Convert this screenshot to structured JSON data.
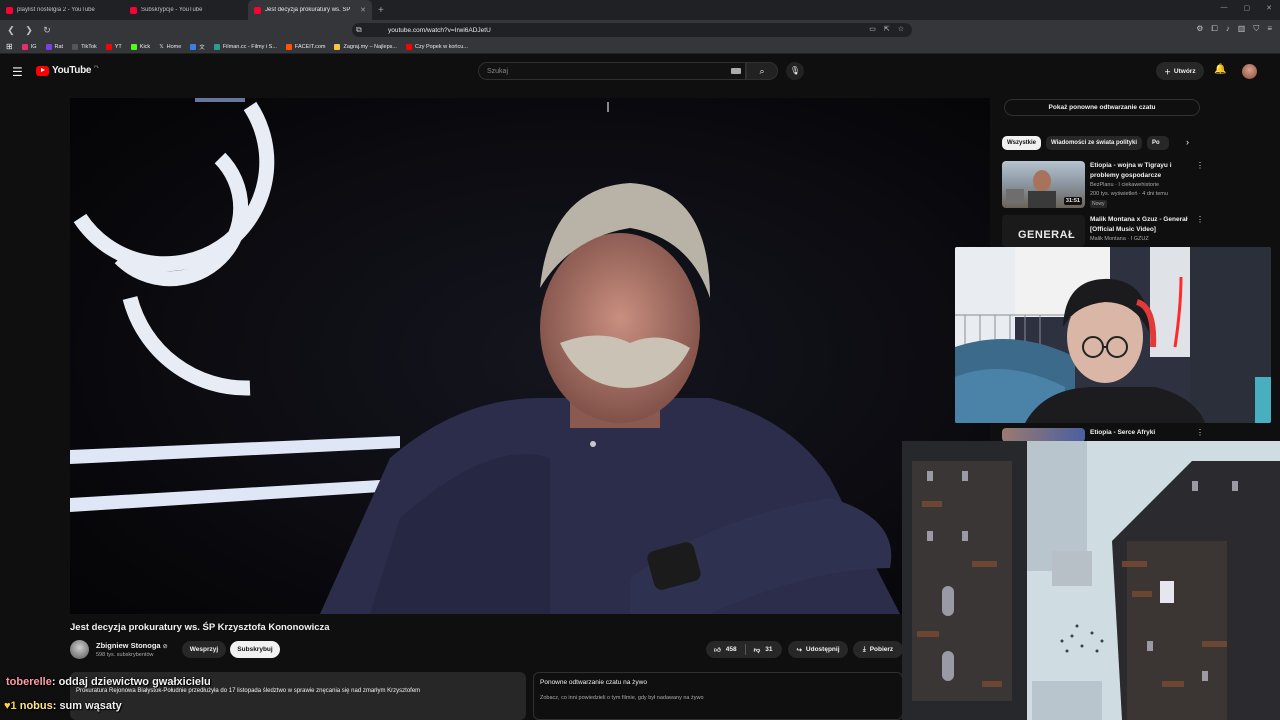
{
  "browser": {
    "tabs": [
      {
        "label": "playlist nostelgia 2 - YouTube",
        "active": false
      },
      {
        "label": "Subskrypcje - YouTube",
        "active": false
      },
      {
        "label": "Jest decyzja prokuratury ws. ŚP",
        "active": true
      }
    ],
    "new_tab": "+",
    "url": "youtube.com/watch?v=Irwi6ADJetU",
    "bookmarks": [
      {
        "label": "IG",
        "color": "#e1306c"
      },
      {
        "label": "Rat",
        "color": "#7b3fe4"
      },
      {
        "label": "TikTok",
        "color": "#111111"
      },
      {
        "label": "YT",
        "color": "#ff0000"
      },
      {
        "label": "Kick",
        "color": "#53fc18"
      },
      {
        "label": "Home",
        "color": "#000000"
      },
      {
        "label": "",
        "color": "#3d7ee6"
      },
      {
        "label": "Filman.cc - Filmy i S...",
        "color": "#2a9d8f"
      },
      {
        "label": "FACEIT.com",
        "color": "#ff5500"
      },
      {
        "label": "Zagraj.my – Najleps...",
        "color": "#f4c542"
      },
      {
        "label": "Czy Popek w końcu...",
        "color": "#ff0000"
      }
    ]
  },
  "youtube": {
    "logo": "YouTube",
    "logo_cc": "PL",
    "search_placeholder": "Szukaj",
    "create_label": "Utwórz",
    "video": {
      "title": "Jest decyzja prokuratury ws. ŚP Krzysztofa Kononowicza",
      "channel": "Zbigniew Stonoga",
      "subscribers": "598 tys. subskrybentów",
      "support_label": "Wesprzyj",
      "subscribe_label": "Subskrybuj",
      "likes": "458",
      "dislikes": "31",
      "share_label": "Udostępnij",
      "download_label": "Pobierz",
      "description": "Prokuratura Rejonowa Białystok-Południe przedłużyła do 17 listopada śledztwo w sprawie znęcania się nad zmarłym Krzysztofem"
    },
    "chat_replay_button": "Pokaż ponowne odtwarzanie czatu",
    "replay_box_title": "Ponowne odtwarzanie czatu na żywo",
    "replay_box_sub": "Zobacz, co inni powiedzieli o tym filmie, gdy był nadawany na żywo",
    "chips": [
      "Wszystkie",
      "Wiadomości ze świata polityki",
      "Po"
    ],
    "recommendations": [
      {
        "title": "Etiopia - wojna w Tigrayu i problemy gospodarcze",
        "channel": "BezPlanu · I ciekawehistorie",
        "views": "200 tys. wyświetleń · 4 dni temu",
        "badge": "Nowy",
        "duration": "31:51"
      },
      {
        "title": "Malik Montana x Gzuz - Generał [Official Music Video]",
        "channel": "Malik Montana · I GZUZ",
        "views": "",
        "badge": "",
        "duration": "",
        "thumb_text": "GENERAŁ"
      },
      {
        "title": "Etiopia - Serce Afryki",
        "channel": "",
        "views": "",
        "badge": "",
        "duration": ""
      }
    ]
  },
  "stream_chat": [
    {
      "user": "toberelle",
      "message": ": oddaj dziewictwo gwałxicielu",
      "badge": ""
    },
    {
      "user": "nobus",
      "message": ": sum wąsaty",
      "badge": "♥1"
    }
  ]
}
